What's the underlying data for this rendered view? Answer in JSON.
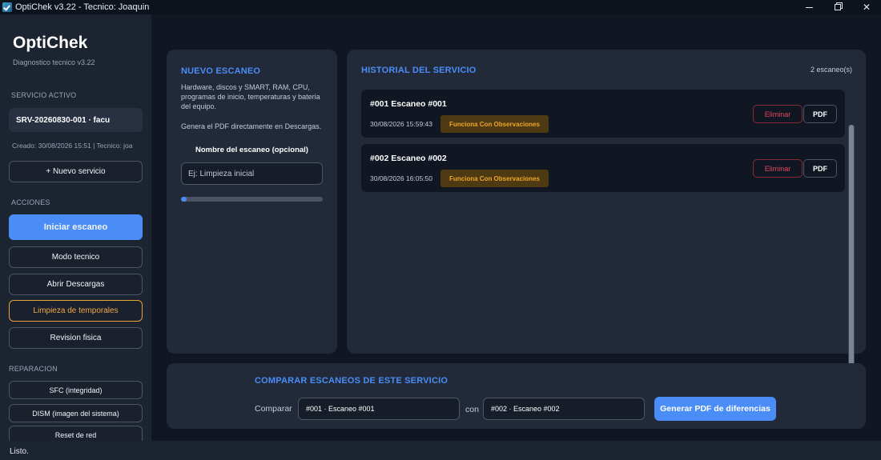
{
  "window": {
    "title": "OptiChek v3.22 - Tecnico: Joaquin",
    "minimize_glyph": "",
    "close_glyph": "✕"
  },
  "sidebar": {
    "brand": "OptiChek",
    "subtitle": "Diagnostico tecnico v3.22",
    "active_service_label": "SERVICIO ACTIVO",
    "active_service": "SRV-20260830-001  ·  facu",
    "created": "Creado: 30/08/2026 15:51 | Tecnico: joa",
    "new_service": "+ Nuevo servicio",
    "actions_label": "ACCIONES",
    "actions": {
      "start_scan": "Iniciar escaneo",
      "tech_mode": "Modo tecnico",
      "open_downloads": "Abrir Descargas",
      "clean_temp": "Limpieza de temporales",
      "physical_review": "Revision fisica"
    },
    "repair_label": "REPARACION",
    "repair": {
      "sfc": "SFC (integridad)",
      "dism": "DISM (imagen del sistema)",
      "network_reset": "Reset de red"
    }
  },
  "new_scan": {
    "title": "NUEVO ESCANEO",
    "description": "Hardware, discos y SMART, RAM, CPU, programas de inicio, temperaturas y bateria del equipo.",
    "pdf_note": "Genera el PDF directamente en Descargas.",
    "name_label": "Nombre del escaneo (opcional)",
    "name_placeholder": "Ej: Limpieza inicial",
    "progress_fraction": 0.04
  },
  "history": {
    "title": "HISTORIAL DEL SERVICIO",
    "count": "2 escaneo(s)",
    "delete_label": "Eliminar",
    "pdf_label": "PDF",
    "scans": [
      {
        "title": "#001  Escaneo #001",
        "date": "30/08/2026 15:59:43",
        "status": "Funciona Con Observaciones"
      },
      {
        "title": "#002  Escaneo #002",
        "date": "30/08/2026 16:05:50",
        "status": "Funciona Con Observaciones"
      }
    ]
  },
  "compare": {
    "title": "COMPARAR ESCANEOS DE ESTE SERVICIO",
    "compare_label": "Comparar",
    "with_label": "con",
    "left_value": "#001 · Escaneo #001",
    "right_value": "#002 · Escaneo #002",
    "generate_button": "Generar PDF de diferencias"
  },
  "status": {
    "text": "Listo."
  },
  "colors": {
    "accent": "#4a8df6",
    "warning": "#f0a52a",
    "danger": "#e04a5c",
    "background": "#111722",
    "panel": "#222a3a"
  }
}
